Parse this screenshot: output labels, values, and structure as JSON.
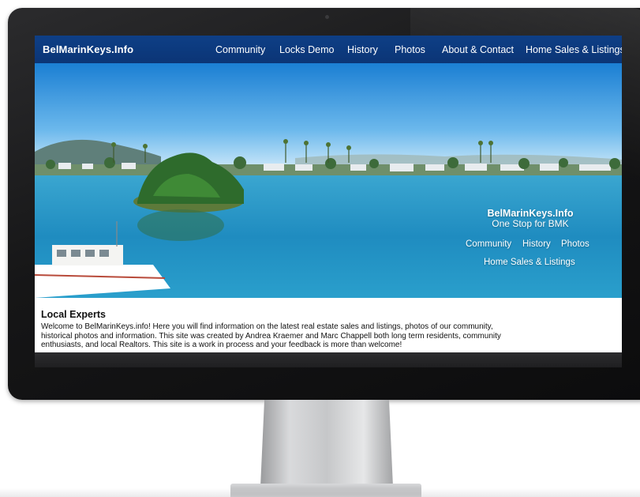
{
  "header": {
    "brand": "BelMarinKeys.Info",
    "nav": [
      {
        "label": "Community"
      },
      {
        "label": "Locks Demo"
      },
      {
        "label": "History"
      },
      {
        "label": "Photos"
      },
      {
        "label": "About & Contact"
      },
      {
        "label": "Home Sales & Listings"
      }
    ]
  },
  "hero": {
    "title": "BelMarinKeys.Info",
    "subtitle": "One Stop for BMK",
    "links": [
      {
        "label": "Community"
      },
      {
        "label": "History"
      },
      {
        "label": "Photos"
      },
      {
        "label": "Home Sales & Listings"
      }
    ]
  },
  "content": {
    "heading": "Local Experts",
    "intro": "Welcome to BelMarinKeys.info! Here you will find information on the latest real estate sales and listings, photos of our community, historical photos and information. This site was created by Andrea Kraemer and Marc Chappell both long term residents, community enthusiasts, and local Realtors. This site is a work in process and your feedback is more than welcome!"
  }
}
